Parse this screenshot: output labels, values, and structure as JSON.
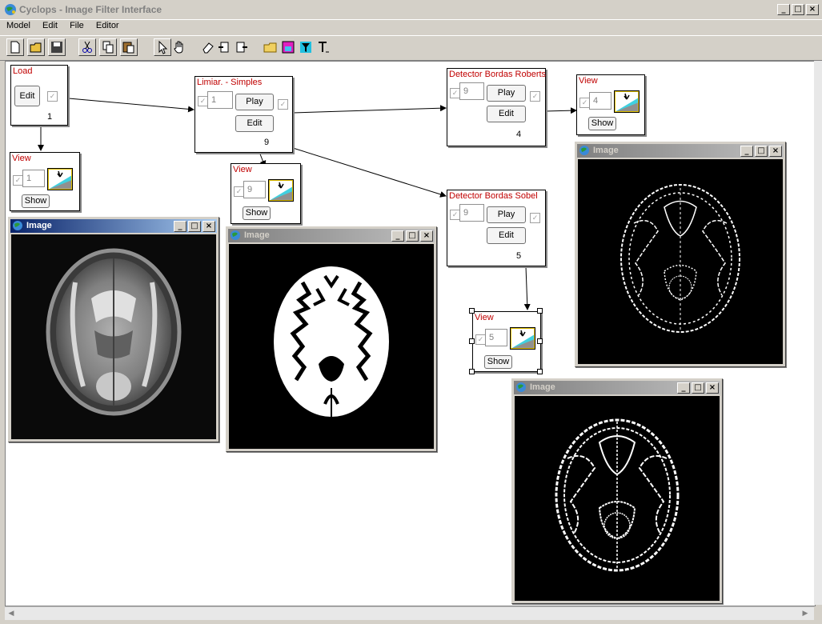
{
  "app": {
    "title": "Cyclops - Image Filter Interface",
    "window_buttons": [
      "_",
      "□",
      "×"
    ]
  },
  "menu": [
    "Model",
    "Edit",
    "File",
    "Editor"
  ],
  "toolbar": {
    "icons": [
      "new-file-icon",
      "open-folder-icon",
      "save-icon",
      "cut-icon",
      "copy-icon",
      "paste-icon",
      "pointer-icon",
      "hand-icon",
      "eraser-icon",
      "import-icon",
      "export-icon",
      "open-image-icon",
      "image-edit-icon",
      "filter-icon",
      "text-tool-icon"
    ]
  },
  "nodes": {
    "load": {
      "title": "Load",
      "edit": "Edit",
      "number": "1"
    },
    "limiar": {
      "title": "Limiar. - Simples",
      "field": "1",
      "play": "Play",
      "edit": "Edit",
      "number": "9"
    },
    "roberts": {
      "title": "Detector Bordas Roberts",
      "field": "9",
      "play": "Play",
      "edit": "Edit",
      "number": "4"
    },
    "sobel": {
      "title": "Detector Bordas Sobel",
      "field": "9",
      "play": "Play",
      "edit": "Edit",
      "number": "5"
    },
    "view1": {
      "title": "View",
      "field": "1",
      "show": "Show"
    },
    "view9": {
      "title": "View",
      "field": "9",
      "show": "Show"
    },
    "view4": {
      "title": "View",
      "field": "4",
      "show": "Show"
    },
    "view5": {
      "title": "View",
      "field": "5",
      "show": "Show"
    }
  },
  "image_windows": {
    "original": {
      "title": "Image"
    },
    "threshold": {
      "title": "Image"
    },
    "roberts": {
      "title": "Image"
    },
    "sobel": {
      "title": "Image"
    }
  },
  "colors": {
    "node_title": "#c00000",
    "titlebar_active": "#0a246a",
    "titlebar_inactive": "#808080"
  }
}
